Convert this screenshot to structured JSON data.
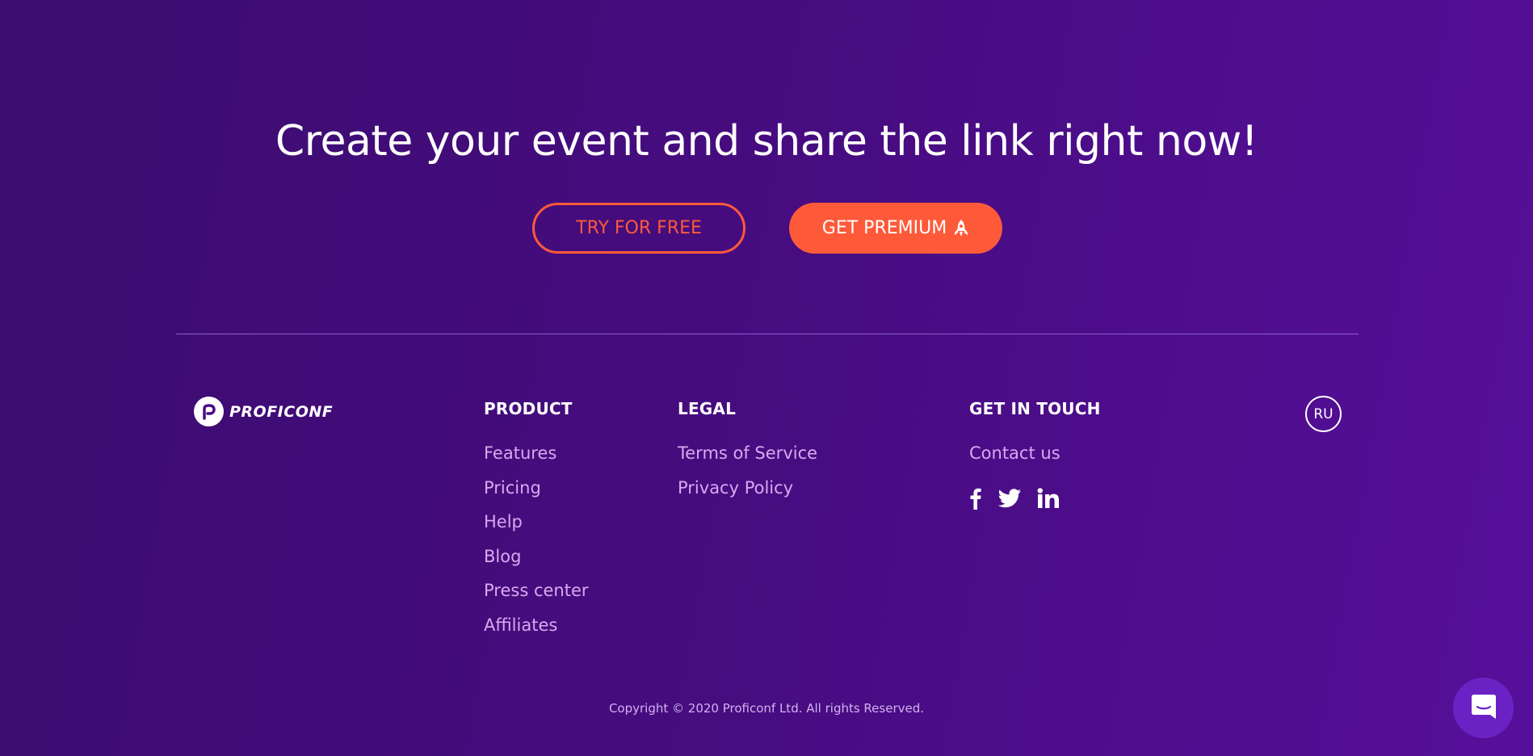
{
  "hero": {
    "headline": "Create your event and share the link right now!",
    "try_free_label": "TRY FOR FREE",
    "premium_label": "GET PREMIUM",
    "premium_icon": "rocket-icon"
  },
  "brand": {
    "name": "PROFICONF",
    "accent_color": "#fe5a3a",
    "link_color": "#d9a8f0"
  },
  "footer": {
    "product": {
      "heading": "PRODUCT",
      "links": [
        "Features",
        "Pricing",
        "Help",
        "Blog",
        "Press center",
        "Affiliates"
      ]
    },
    "legal": {
      "heading": "LEGAL",
      "links": [
        "Terms of Service",
        "Privacy Policy"
      ]
    },
    "touch": {
      "heading": "GET IN TOUCH",
      "links": [
        "Contact us"
      ],
      "socials": [
        "facebook-icon",
        "twitter-icon",
        "linkedin-icon"
      ]
    },
    "language": "RU",
    "copyright": "Copyright © 2020 Proficonf Ltd. All rights Reserved."
  },
  "chat_widget": {
    "icon": "chat-bubble-icon"
  }
}
